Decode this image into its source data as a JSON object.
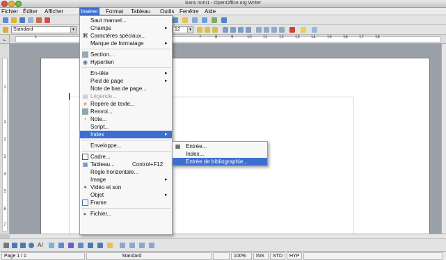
{
  "window": {
    "title": "Sans nom1 - OpenOffice.org Writer"
  },
  "menubar": [
    "Fichier",
    "Éditer",
    "Afficher",
    "Insérer",
    "Format",
    "Tableau",
    "Outils",
    "Fenêtre",
    "Aide"
  ],
  "toolbar": {
    "style_value": "Standard",
    "size_value": "12"
  },
  "ruler": {
    "h_ticks": [
      "1",
      "7",
      "8",
      "9",
      "10",
      "11",
      "12",
      "13",
      "14",
      "15",
      "16",
      "17",
      "18"
    ],
    "v_ticks": [
      "1",
      "1",
      "2",
      "3",
      "4",
      "5",
      "6",
      "7"
    ]
  },
  "insert_menu": {
    "items": [
      {
        "label": "Saut manuel...",
        "icon": "",
        "submenu": false
      },
      {
        "label": "Champs",
        "icon": "",
        "submenu": true
      },
      {
        "label": "Caractères spéciaux...",
        "icon": "special-chars-icon",
        "submenu": false
      },
      {
        "label": "Marque de formatage",
        "icon": "",
        "submenu": true
      },
      {
        "label": "Section...",
        "icon": "section-icon",
        "submenu": false
      },
      {
        "label": "Hyperlien",
        "icon": "hyperlink-icon",
        "submenu": false
      },
      {
        "label": "En-tête",
        "icon": "",
        "submenu": true
      },
      {
        "label": "Pied de page",
        "icon": "",
        "submenu": true
      },
      {
        "label": "Note de bas de page...",
        "icon": "",
        "submenu": false
      },
      {
        "label": "Légende...",
        "icon": "caption-icon",
        "submenu": false,
        "disabled": true
      },
      {
        "label": "Repère de texte...",
        "icon": "bookmark-icon",
        "submenu": false
      },
      {
        "label": "Renvoi...",
        "icon": "cross-reference-icon",
        "submenu": false
      },
      {
        "label": "Note...",
        "icon": "note-icon",
        "submenu": false
      },
      {
        "label": "Script...",
        "icon": "",
        "submenu": false
      },
      {
        "label": "Index",
        "icon": "",
        "submenu": true,
        "highlighted": true
      },
      {
        "label": "Enveloppe...",
        "icon": "",
        "submenu": false
      },
      {
        "label": "Cadre...",
        "icon": "frame-icon",
        "submenu": false
      },
      {
        "label": "Tableau...",
        "icon": "table-icon",
        "submenu": false,
        "shortcut": "Control+F12"
      },
      {
        "label": "Règle horizontale...",
        "icon": "",
        "submenu": false
      },
      {
        "label": "Image",
        "icon": "",
        "submenu": true
      },
      {
        "label": "Vidéo et son",
        "icon": "video-icon",
        "submenu": false
      },
      {
        "label": "Objet",
        "icon": "",
        "submenu": true
      },
      {
        "label": "Frame",
        "icon": "floating-frame-icon",
        "submenu": false
      },
      {
        "label": "Fichier...",
        "icon": "file-icon",
        "submenu": false
      }
    ]
  },
  "index_submenu": {
    "items": [
      {
        "label": "Entrée...",
        "icon": "index-entry-icon"
      },
      {
        "label": "Index...",
        "icon": ""
      },
      {
        "label": "Entrée de bibliographie...",
        "icon": "",
        "highlighted": true
      }
    ]
  },
  "drawbar": {
    "ai_label": "AI"
  },
  "status": {
    "page": "Page 1 / 1",
    "style": "Standard",
    "zoom": "100%",
    "ins": "INS",
    "std": "STD",
    "hyp": "HYP"
  },
  "colors": {
    "accent": "#3d6fd1",
    "doc_bg": "#9aa0a8"
  }
}
